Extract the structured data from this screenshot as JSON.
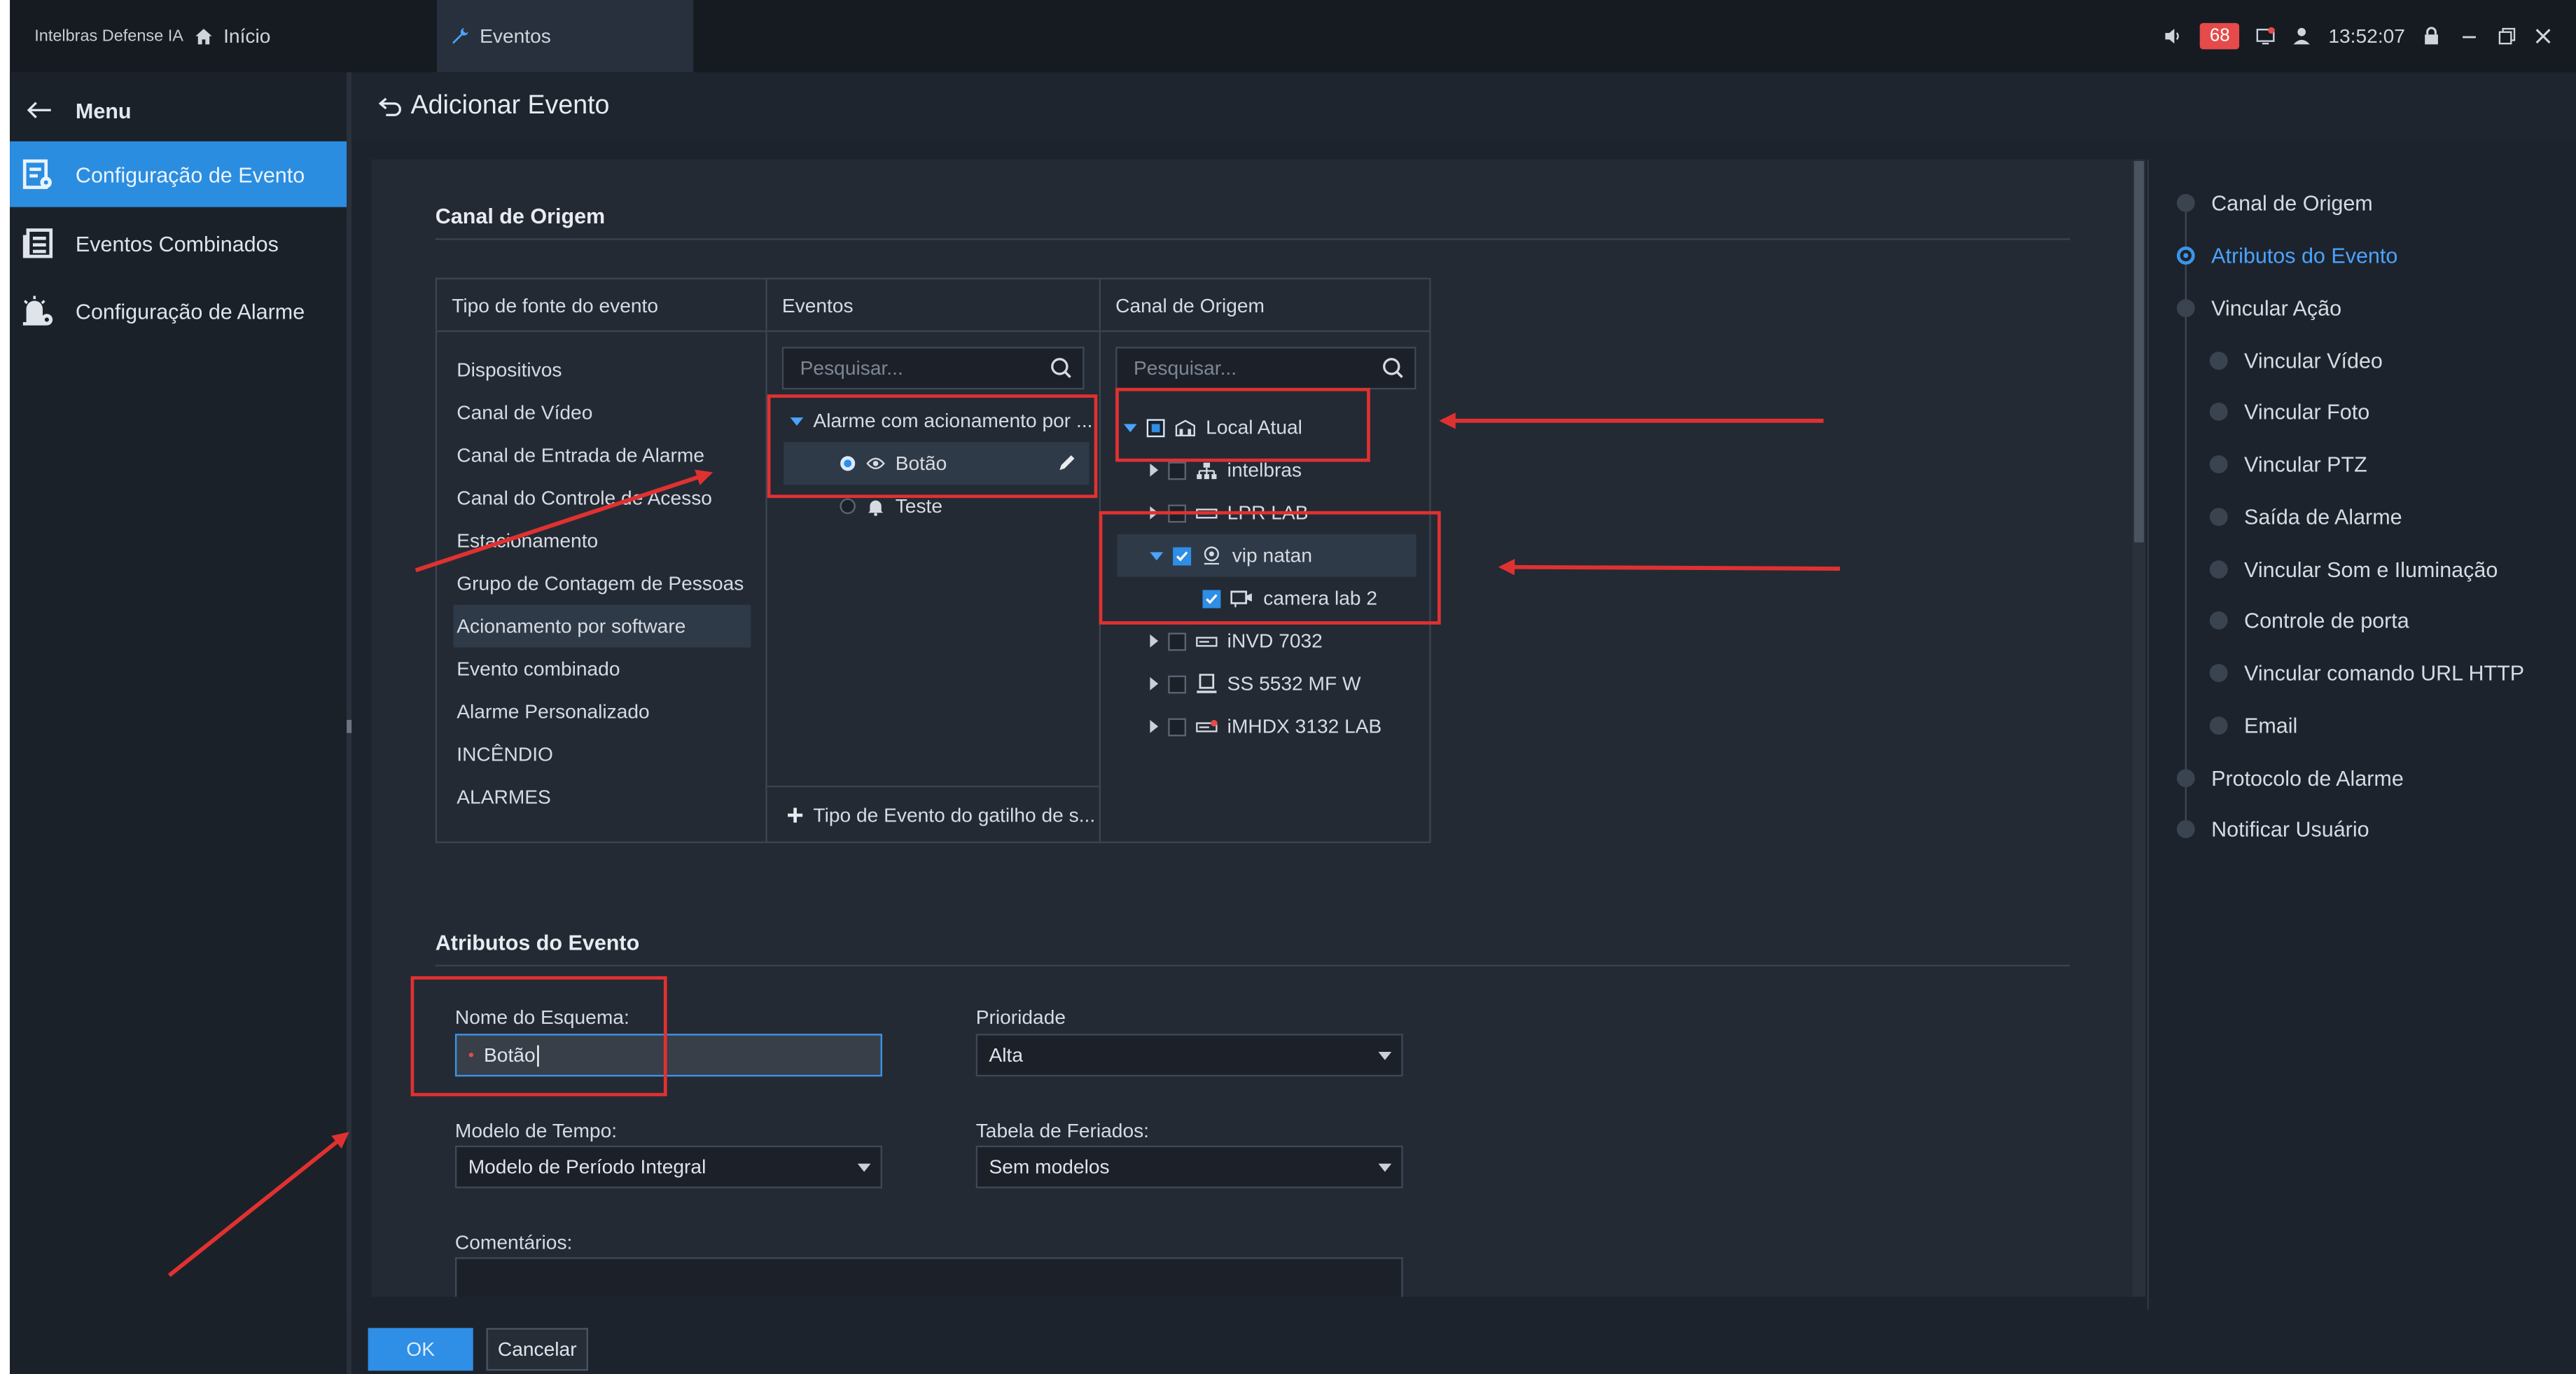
{
  "topbar": {
    "brand": "Intelbras Defense IA",
    "tabs": [
      {
        "label": "Início",
        "icon": "home-icon"
      },
      {
        "label": "Eventos",
        "icon": "wrench-icon"
      }
    ],
    "alarm_count": "68",
    "time": "13:52:07"
  },
  "sidebar": {
    "menu_label": "Menu",
    "items": [
      {
        "label": "Configuração de Evento",
        "icon": "event-config-icon",
        "active": true
      },
      {
        "label": "Eventos Combinados",
        "icon": "combined-events-icon",
        "active": false
      },
      {
        "label": "Configuração de Alarme",
        "icon": "alarm-config-icon",
        "active": false
      }
    ]
  },
  "header": {
    "title": "Adicionar Evento"
  },
  "source_section": {
    "title": "Canal de Origem",
    "columns": [
      "Tipo de fonte do evento",
      "Eventos",
      "Canal de Origem"
    ],
    "source_types": [
      "Dispositivos",
      "Canal de Vídeo",
      "Canal de Entrada de Alarme",
      "Canal do Controle de Acesso",
      "Estacionamento",
      "Grupo de Contagem de Pessoas",
      "Acionamento por software",
      "Evento combinado",
      "Alarme Personalizado",
      "INCÊNDIO",
      "ALARMES"
    ],
    "selected_source": "Acionamento por software",
    "events_search_placeholder": "Pesquisar...",
    "event_group": "Alarme com acionamento por ...",
    "events": [
      {
        "label": "Botão",
        "selected": true
      },
      {
        "label": "Teste",
        "selected": false
      }
    ],
    "add_event_type": "Tipo de Evento do gatilho de s...",
    "channel_search_placeholder": "Pesquisar...",
    "channels": [
      {
        "label": "Local Atual",
        "level": 0,
        "state": "partial",
        "expanded": true
      },
      {
        "label": "intelbras",
        "level": 1,
        "state": "off",
        "expanded": false
      },
      {
        "label": "LPR LAB",
        "level": 1,
        "state": "off",
        "expanded": false
      },
      {
        "label": "vip natan",
        "level": 1,
        "state": "on",
        "expanded": true
      },
      {
        "label": "camera lab 2",
        "level": 2,
        "state": "on",
        "expanded": false
      },
      {
        "label": "iNVD 7032",
        "level": 1,
        "state": "off",
        "expanded": false
      },
      {
        "label": "SS 5532 MF W",
        "level": 1,
        "state": "off",
        "expanded": false
      },
      {
        "label": "iMHDX 3132 LAB",
        "level": 1,
        "state": "off",
        "expanded": false
      }
    ]
  },
  "attributes_section": {
    "title": "Atributos do Evento",
    "scheme_name_label": "Nome do Esquema:",
    "scheme_name_value": "Botão",
    "priority_label": "Prioridade",
    "priority_value": "Alta",
    "time_model_label": "Modelo de Tempo:",
    "time_model_value": "Modelo de Período Integral",
    "holiday_label": "Tabela de Feriados:",
    "holiday_value": "Sem modelos",
    "comments_label": "Comentários:",
    "comments_value": ""
  },
  "buttons": {
    "ok": "OK",
    "cancel": "Cancelar"
  },
  "right_nav": [
    {
      "label": "Canal de Origem",
      "level": 0,
      "active": false
    },
    {
      "label": "Atributos do Evento",
      "level": 0,
      "active": true
    },
    {
      "label": "Vincular Ação",
      "level": 0,
      "active": false
    },
    {
      "label": "Vincular Vídeo",
      "level": 1,
      "active": false
    },
    {
      "label": "Vincular Foto",
      "level": 1,
      "active": false
    },
    {
      "label": "Vincular PTZ",
      "level": 1,
      "active": false
    },
    {
      "label": "Saída de Alarme",
      "level": 1,
      "active": false
    },
    {
      "label": "Vincular Som e Iluminação",
      "level": 1,
      "active": false
    },
    {
      "label": "Controle de porta",
      "level": 1,
      "active": false
    },
    {
      "label": "Vincular comando URL HTTP",
      "level": 1,
      "active": false
    },
    {
      "label": "Email",
      "level": 1,
      "active": false
    },
    {
      "label": "Protocolo de Alarme",
      "level": 0,
      "active": false
    },
    {
      "label": "Notificar Usuário",
      "level": 0,
      "active": false
    }
  ],
  "colors": {
    "accent": "#2f8ee5",
    "annotation_red": "#e03131",
    "alarm_badge": "#e64a4a"
  }
}
